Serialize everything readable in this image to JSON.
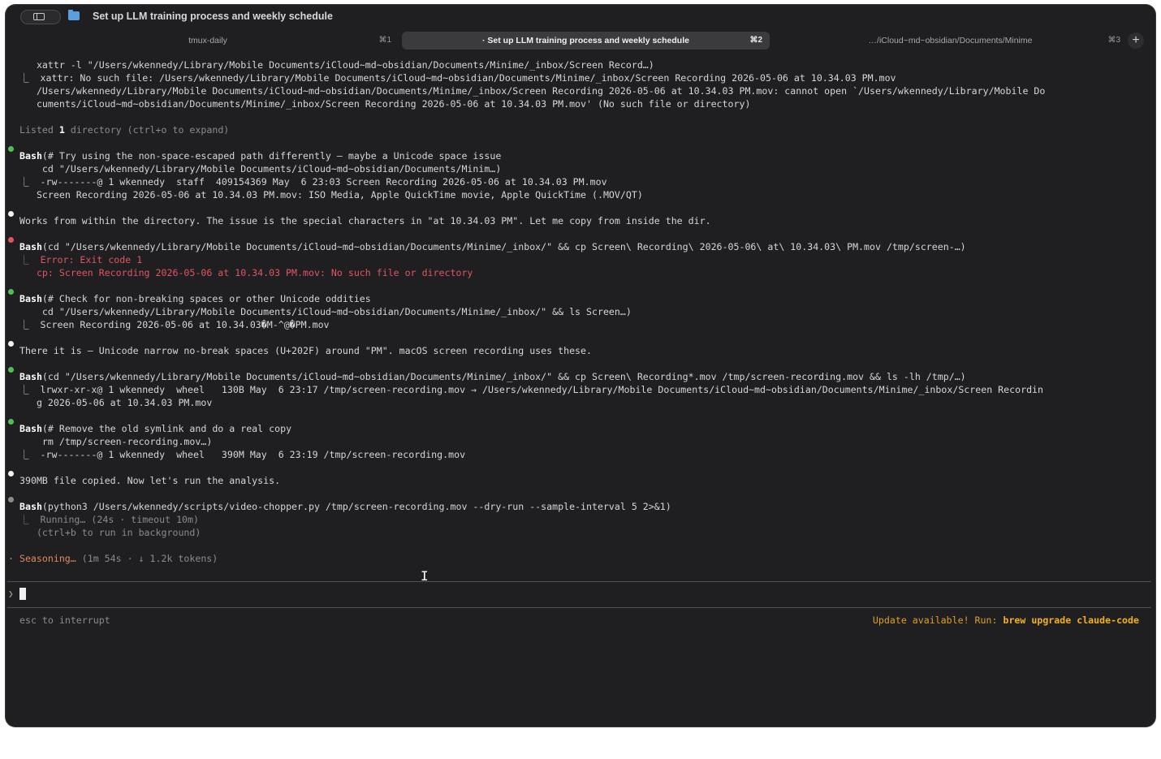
{
  "window": {
    "title": "Set up LLM training process and weekly schedule"
  },
  "tabs": [
    {
      "label": "tmux-daily",
      "shortcut": "⌘1",
      "active": false
    },
    {
      "label": "· Set up LLM training process and weekly schedule",
      "shortcut": "⌘2",
      "active": true
    },
    {
      "label": "…/iCloud~md~obsidian/Documents/Minime",
      "shortcut": "⌘3",
      "active": false
    }
  ],
  "new_tab_label": "+",
  "terminal": {
    "l01": "   xattr -l \"/Users/wkennedy/Library/Mobile Documents/iCloud~md~obsidian/Documents/Minime/_inbox/Screen Record…)",
    "l02": "⎿  xattr: No such file: /Users/wkennedy/Library/Mobile Documents/iCloud~md~obsidian/Documents/Minime/_inbox/Screen Recording 2026-05-06 at 10.34.03 PM.mov",
    "l03": "   /Users/wkennedy/Library/Mobile Documents/iCloud~md~obsidian/Documents/Minime/_inbox/Screen Recording 2026-05-06 at 10.34.03 PM.mov: cannot open `/Users/wkennedy/Library/Mobile Do",
    "l04": "   cuments/iCloud~md~obsidian/Documents/Minime/_inbox/Screen Recording 2026-05-06 at 10.34.03 PM.mov' (No such file or directory)",
    "l05_prefix": "Listed ",
    "l05_bold": "1",
    "l05_suffix": " directory (ctrl+o to expand)",
    "l06_tool": "Bash",
    "l06": "(# Try using the non-space-escaped path differently — maybe a Unicode space issue",
    "l07": "    cd \"/Users/wkennedy/Library/Mobile Documents/iCloud~md~obsidian/Documents/Minim…)",
    "l08": "⎿  -rw-------@ 1 wkennedy  staff  409154369 May  6 23:03 Screen Recording 2026-05-06 at 10.34.03 PM.mov",
    "l09": "   Screen Recording 2026-05-06 at 10.34.03 PM.mov: ISO Media, Apple QuickTime movie, Apple QuickTime (.MOV/QT)",
    "l10": "Works from within the directory. The issue is the special characters in \"at 10.34.03 PM\". Let me copy from inside the dir.",
    "l11_tool": "Bash",
    "l11": "(cd \"/Users/wkennedy/Library/Mobile Documents/iCloud~md~obsidian/Documents/Minime/_inbox/\" && cp Screen\\ Recording\\ 2026-05-06\\ at\\ 10.34.03\\ PM.mov /tmp/screen-…)",
    "l12": "Error: Exit code 1",
    "l13": "   cp: Screen Recording 2026-05-06 at 10.34.03 PM.mov: No such file or directory",
    "l14_tool": "Bash",
    "l14": "(# Check for non-breaking spaces or other Unicode oddities",
    "l15": "    cd \"/Users/wkennedy/Library/Mobile Documents/iCloud~md~obsidian/Documents/Minime/_inbox/\" && ls Screen…)",
    "l16": "⎿  Screen Recording 2026-05-06 at 10.34.03�M-^@�PM.mov",
    "l17": "There it is — Unicode narrow no-break spaces (U+202F) around \"PM\". macOS screen recording uses these.",
    "l18_tool": "Bash",
    "l18": "(cd \"/Users/wkennedy/Library/Mobile Documents/iCloud~md~obsidian/Documents/Minime/_inbox/\" && cp Screen\\ Recording*.mov /tmp/screen-recording.mov && ls -lh /tmp/…)",
    "l19": "⎿  lrwxr-xr-x@ 1 wkennedy  wheel   130B May  6 23:17 /tmp/screen-recording.mov → /Users/wkennedy/Library/Mobile Documents/iCloud~md~obsidian/Documents/Minime/_inbox/Screen Recordin",
    "l20": "   g 2026-05-06 at 10.34.03 PM.mov",
    "l21_tool": "Bash",
    "l21": "(# Remove the old symlink and do a real copy",
    "l22": "    rm /tmp/screen-recording.mov…)",
    "l23": "⎿  -rw-------@ 1 wkennedy  wheel   390M May  6 23:19 /tmp/screen-recording.mov",
    "l24": "390MB file copied. Now let's run the analysis.",
    "l25_tool": "Bash",
    "l25": "(python3 /Users/wkennedy/scripts/video-chopper.py /tmp/screen-recording.mov --dry-run --sample-interval 5 2>&1)",
    "l26": "⎿  Running… (24s · timeout 10m)",
    "l27": "   (ctrl+b to run in background)",
    "status_word": "· Seasoning…",
    "status_detail": " (1m 54s · ↓ 1.2k tokens)"
  },
  "prompt": {
    "symbol": "❯"
  },
  "footer": {
    "left": "esc to interrupt",
    "right_prefix": "Update available! Run: ",
    "right_cmd": "brew upgrade claude-code"
  },
  "colors": {
    "background": "#1f1f21",
    "success_bullet": "#4fbf5a",
    "error": "#e0555f",
    "status_orange": "#e08860",
    "update_yellow": "#e0a020"
  }
}
